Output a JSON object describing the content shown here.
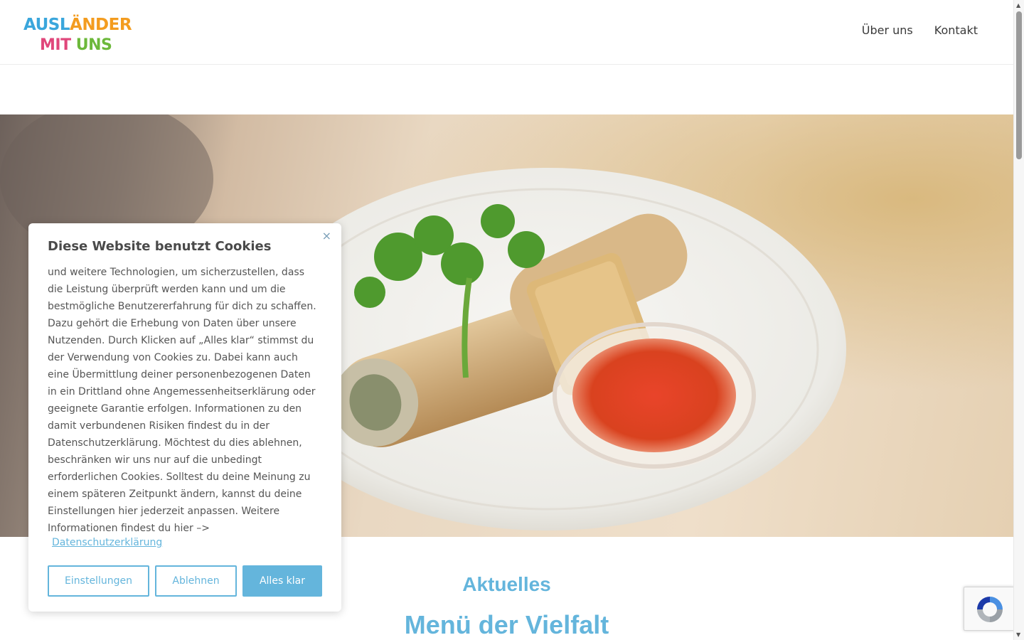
{
  "header": {
    "logo": {
      "line1": [
        "AUSL",
        "Ä",
        "NDER"
      ],
      "line2": [
        "MIT",
        "UNS"
      ]
    },
    "nav": [
      {
        "label": "Über uns"
      },
      {
        "label": "Kontakt"
      }
    ]
  },
  "hero": {
    "icon": "food-photo"
  },
  "main": {
    "subtitle": "Aktuelles",
    "title": "Menü der Vielfalt"
  },
  "cookie": {
    "title": "Diese Website benutzt Cookies",
    "text": "und weitere Technologien, um sicherzustellen, dass die Leistung überprüft werden kann und um die bestmögliche Benutzererfahrung für dich zu schaffen. Dazu gehört die Erhebung von Daten über unsere Nutzenden. Durch Klicken auf „Alles klar“ stimmst du der Verwendung von Cookies zu. Dabei kann auch eine Übermittlung deiner personenbezogenen Daten in ein Drittland ohne Angemessenheitserklärung oder geeignete Garantie erfolgen. Informationen zu den damit verbundenen Risiken findest du in der Datenschutzerklärung. Möchtest du dies ablehnen, beschränken wir uns nur auf die unbedingt erforderlichen Cookies. Solltest du deine Meinung zu einem späteren Zeitpunkt ändern, kannst du deine Einstellungen hier jederzeit anpassen. Weitere Informationen findest du hier –>",
    "link": "Datenschutzerklärung",
    "close": "×",
    "buttons": {
      "settings": "Einstellungen",
      "reject": "Ablehnen",
      "accept": "Alles klar"
    }
  },
  "colors": {
    "accent": "#64b5dc",
    "logo_blue": "#3aa6dc",
    "logo_orange": "#f39c1f",
    "logo_pink": "#e0477b",
    "logo_green": "#6cb83a"
  }
}
